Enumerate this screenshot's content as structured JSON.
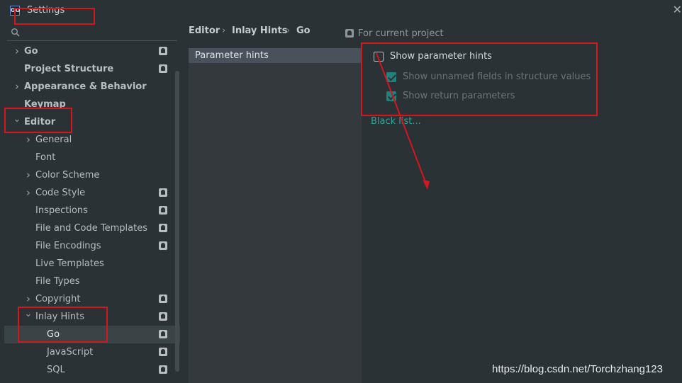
{
  "window": {
    "title": "Settings",
    "app_icon_text": "GO"
  },
  "search": {
    "icon": "search-icon"
  },
  "tree": [
    {
      "label": "Go",
      "bold": true,
      "arrow": "right",
      "project": true
    },
    {
      "label": "Project Structure",
      "bold": true,
      "arrow": "",
      "project": true
    },
    {
      "label": "Appearance & Behavior",
      "bold": true,
      "arrow": "right",
      "project": false
    },
    {
      "label": "Keymap",
      "bold": true,
      "arrow": "",
      "project": false
    },
    {
      "label": "Editor",
      "bold": true,
      "arrow": "down",
      "project": false
    },
    {
      "label": "General",
      "bold": false,
      "arrow": "right",
      "project": false
    },
    {
      "label": "Font",
      "bold": false,
      "arrow": "",
      "project": false
    },
    {
      "label": "Color Scheme",
      "bold": false,
      "arrow": "right",
      "project": false
    },
    {
      "label": "Code Style",
      "bold": false,
      "arrow": "right",
      "project": true
    },
    {
      "label": "Inspections",
      "bold": false,
      "arrow": "",
      "project": true
    },
    {
      "label": "File and Code Templates",
      "bold": false,
      "arrow": "",
      "project": true
    },
    {
      "label": "File Encodings",
      "bold": false,
      "arrow": "",
      "project": true
    },
    {
      "label": "Live Templates",
      "bold": false,
      "arrow": "",
      "project": false
    },
    {
      "label": "File Types",
      "bold": false,
      "arrow": "",
      "project": false
    },
    {
      "label": "Copyright",
      "bold": false,
      "arrow": "right",
      "project": true
    },
    {
      "label": "Inlay Hints",
      "bold": false,
      "arrow": "down",
      "project": true
    },
    {
      "label": "Go",
      "bold": false,
      "arrow": "",
      "project": true,
      "selected": true
    },
    {
      "label": "JavaScript",
      "bold": false,
      "arrow": "",
      "project": true
    },
    {
      "label": "SQL",
      "bold": false,
      "arrow": "",
      "project": true
    }
  ],
  "breadcrumb": [
    "Editor",
    "Inlay Hints",
    "Go"
  ],
  "breadcrumb_sep": "›",
  "scope_label": "For current project",
  "hint_list": [
    "Parameter hints"
  ],
  "options": {
    "show_parameter_hints": {
      "label": "Show parameter hints",
      "checked": false
    },
    "show_unnamed_fields": {
      "label": "Show unnamed fields in structure values",
      "checked": true,
      "enabled": false
    },
    "show_return_parameters": {
      "label": "Show return parameters",
      "checked": true,
      "enabled": false
    }
  },
  "blacklist_link": "Black list...",
  "watermark": "https://blog.csdn.net/Torchzhang123",
  "colors": {
    "annotation_red": "#d4161e",
    "selected_list": "#49525a",
    "link": "#2da49a",
    "background": "#2b3235"
  }
}
